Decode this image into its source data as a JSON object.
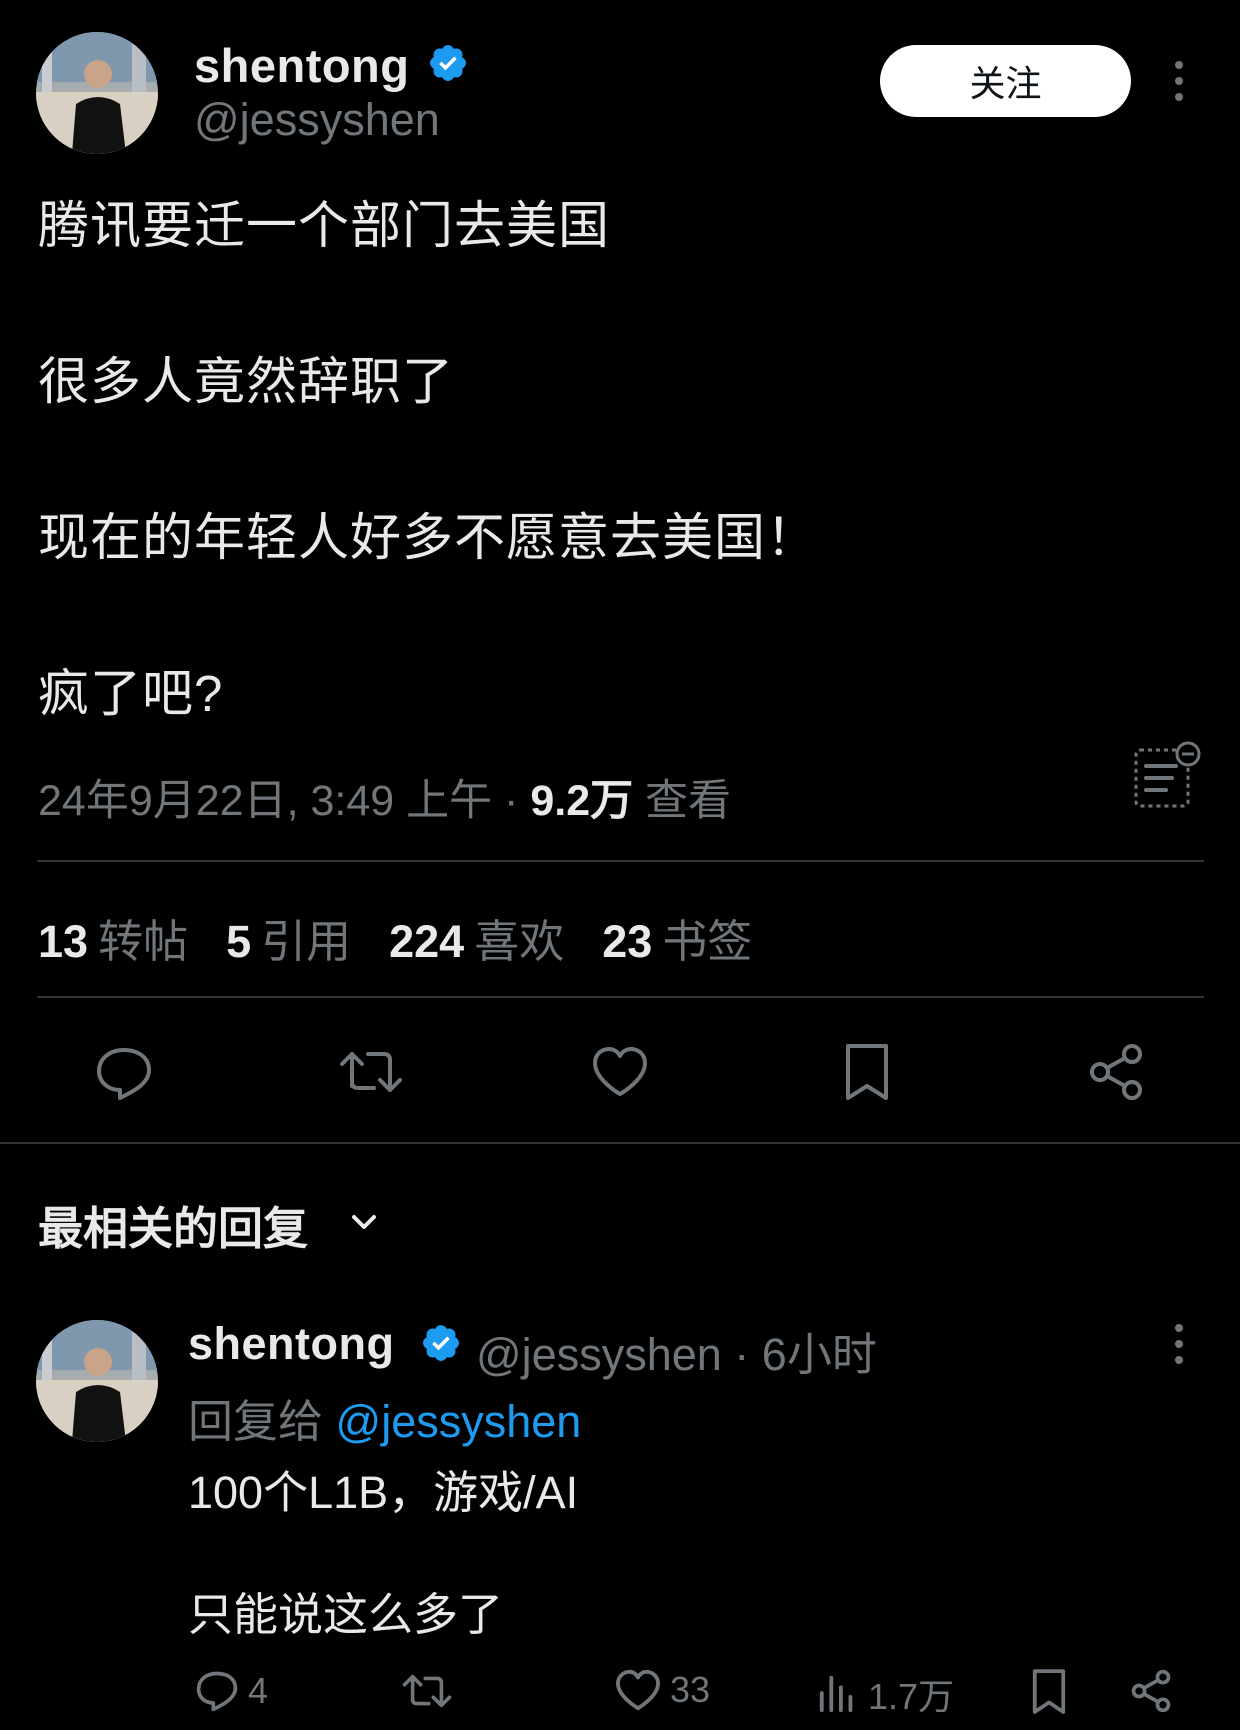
{
  "post": {
    "author": {
      "display_name": "shentong",
      "handle": "@jessyshen",
      "verified": true
    },
    "follow_label": "关注",
    "text_lines": [
      "腾讯要迁一个部门去美国",
      "很多人竟然辞职了",
      "现在的年轻人好多不愿意去美国！",
      "疯了吧?"
    ],
    "timestamp": "24年9月22日, 3:49 上午 · ",
    "views_value": "9.2万",
    "views_label": " 查看",
    "stats": {
      "reposts": {
        "value": "13",
        "label": "转帖"
      },
      "quotes": {
        "value": "5",
        "label": "引用"
      },
      "likes": {
        "value": "224",
        "label": "喜欢"
      },
      "bookmarks": {
        "value": "23",
        "label": "书签"
      }
    }
  },
  "replies_section": {
    "sort_label": "最相关的回复"
  },
  "reply": {
    "author": {
      "display_name": "shentong",
      "handle": "@jessyshen",
      "verified": true
    },
    "time": " · 6小时",
    "reply_to_prefix": "回复给 ",
    "reply_to_handle": "@jessyshen",
    "text_lines": [
      "100个L1B，游戏/AI",
      "只能说这么多了"
    ],
    "counts": {
      "replies": "4",
      "likes": "33",
      "views": "1.7万"
    }
  },
  "colors": {
    "background": "#000000",
    "text_primary": "#e7e9ea",
    "text_secondary": "#71767b",
    "accent": "#1d9bf0",
    "divider": "#2f3336",
    "follow_button_bg": "#ffffff"
  },
  "icons": {
    "verified": "verified-badge-icon",
    "more": "more-vertical-icon",
    "analytics": "post-analytics-icon",
    "reply": "reply-icon",
    "repost": "repost-icon",
    "like": "heart-icon",
    "bookmark": "bookmark-icon",
    "share": "share-icon",
    "views": "views-bar-chart-icon",
    "dropdown": "chevron-down-icon"
  }
}
